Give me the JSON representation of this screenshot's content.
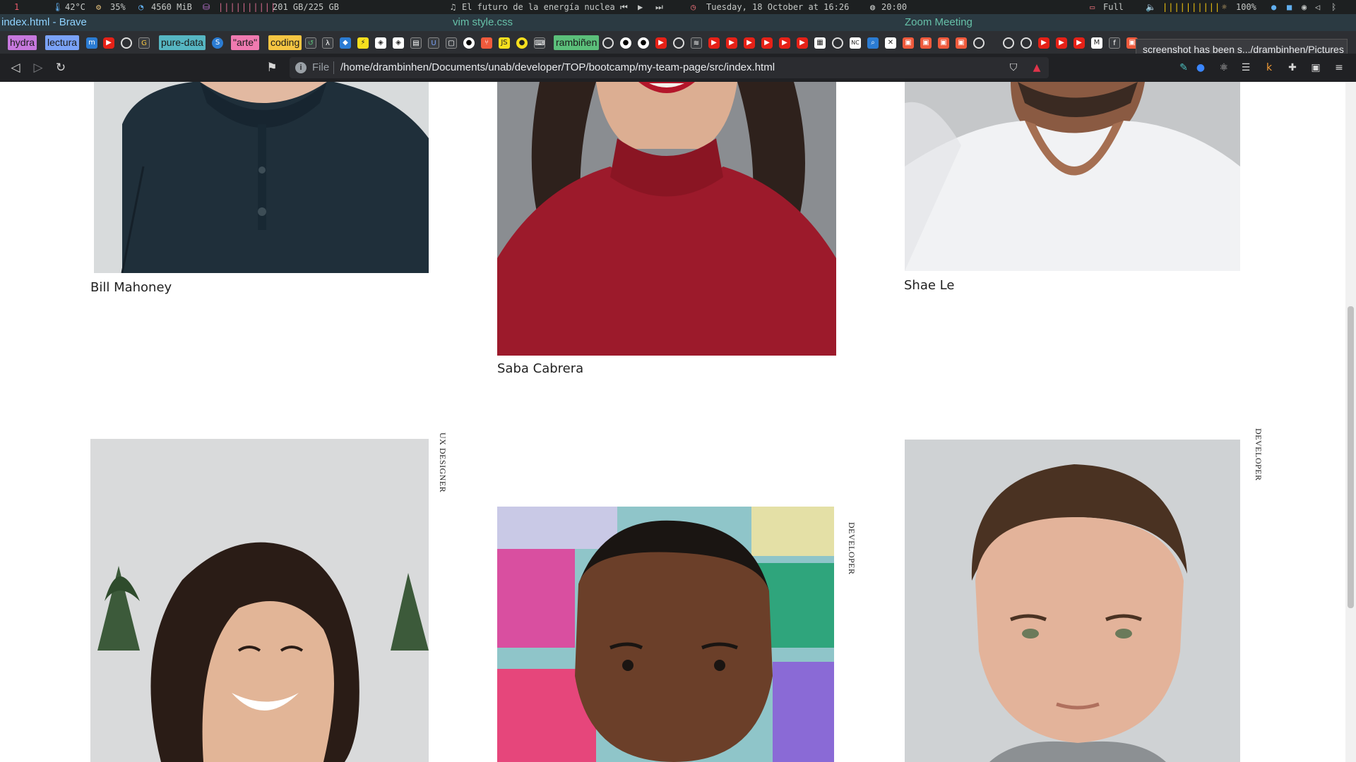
{
  "statusbar": {
    "workspace": "1",
    "temperature": "42°C",
    "cpu": "35%",
    "memory": "4560 MiB",
    "disk_bars": "||||||||||",
    "disk": "201 GB/225 GB",
    "music": "El futuro de la energía nuclea",
    "datetime": "Tuesday, 18 October at 16:26",
    "timer": "20:00",
    "battery": "Full",
    "volume_bars": "||||||||||",
    "brightness": "100%"
  },
  "windows": {
    "left": "index.html - Brave",
    "center": "vim style.css",
    "right": "Zoom Meeting"
  },
  "bookmarks": {
    "tags": [
      {
        "label": "hydra",
        "color": "#c678dd"
      },
      {
        "label": "lectura",
        "color": "#7aa2f7"
      },
      {
        "label": "pure-data",
        "color": "#56b6c2"
      },
      {
        "label": "\"arte\"",
        "color": "#f07ab0"
      },
      {
        "label": "coding",
        "color": "#f5c542"
      },
      {
        "label": "rambiñen",
        "color": "#5bbf7a"
      }
    ]
  },
  "navbar": {
    "back": "◁",
    "forward": "▷",
    "reload": "↻",
    "file_label": "File",
    "url": "/home/drambinhen/Documents/unab/developer/TOP/bootcamp/my-team-page/src/index.html"
  },
  "toast": "screenshot has been s.../drambinhen/Pictures",
  "team": {
    "members": [
      {
        "name": "Bill Mahoney"
      },
      {
        "name": "Saba Cabrera"
      },
      {
        "name": "Shae Le"
      },
      {
        "role": "UX DESIGNER"
      },
      {
        "role": "DEVELOPER"
      },
      {
        "role": "DEVELOPER"
      }
    ]
  },
  "colors": {
    "shirt_navy": "#1f2f3a",
    "sweater_red": "#9c1a2b",
    "tshirt_white": "#f1f2f4",
    "photo_gray": "#cfd2d4"
  }
}
